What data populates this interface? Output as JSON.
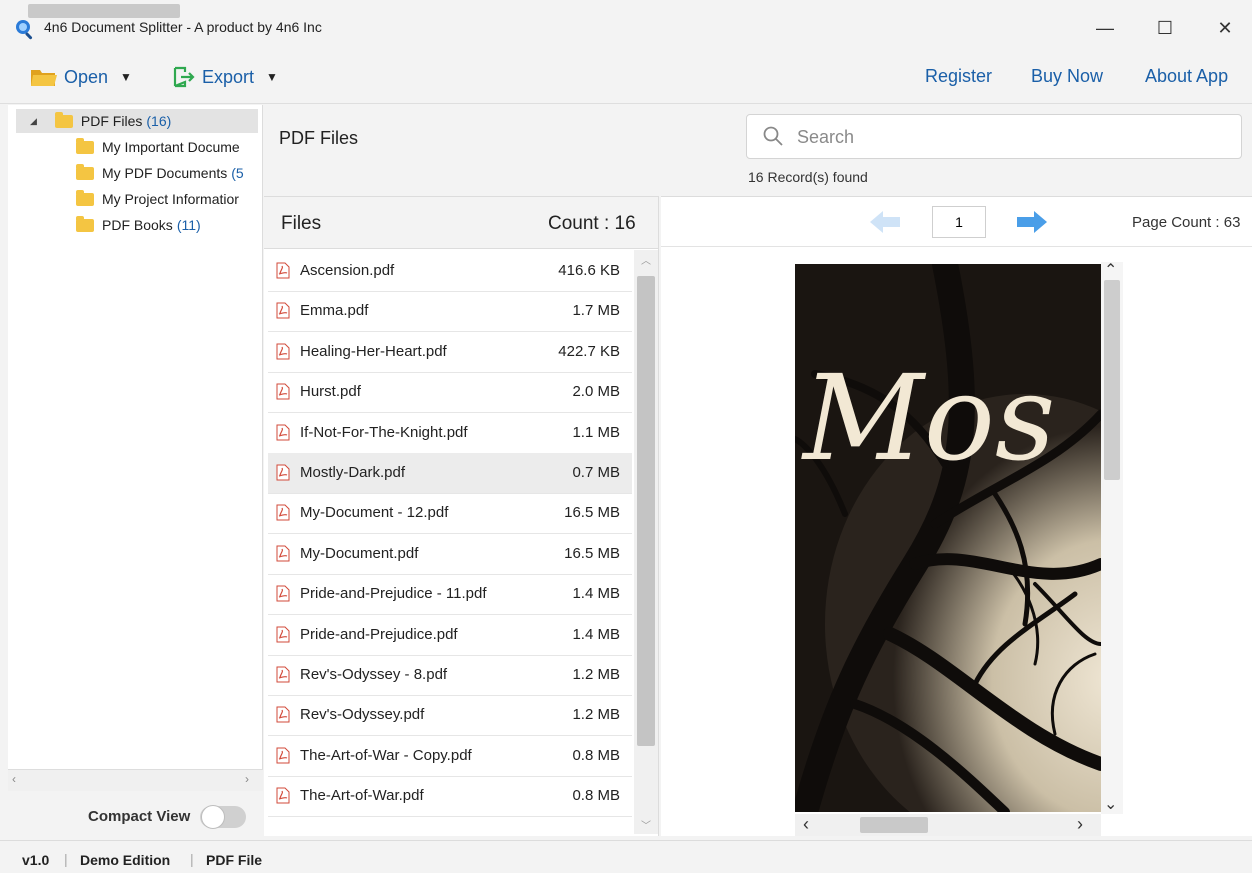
{
  "window": {
    "title": "4n6 Document Splitter - A product by 4n6 Inc",
    "minimize_glyph": "—",
    "maximize_glyph": "☐",
    "close_glyph": "✕"
  },
  "toolbar": {
    "open_label": "Open",
    "export_label": "Export",
    "register_label": "Register",
    "buy_now_label": "Buy Now",
    "about_label": "About App",
    "accent_color": "#1a5fa8"
  },
  "tree": {
    "root": {
      "label": "PDF Files",
      "count": "(16)"
    },
    "items": [
      {
        "label": "My Important Docume",
        "count": ""
      },
      {
        "label": "My PDF Documents",
        "count": "(5"
      },
      {
        "label": "My Project Informatior",
        "count": ""
      },
      {
        "label": "PDF Books",
        "count": "(11)"
      }
    ],
    "compact_view_label": "Compact View"
  },
  "main": {
    "title": "PDF Files",
    "search_placeholder": "Search",
    "records_found": "16 Record(s) found"
  },
  "files": {
    "header_label": "Files",
    "count_label": "Count : 16",
    "rows": [
      {
        "name": "Ascension.pdf",
        "size": "416.6 KB"
      },
      {
        "name": "Emma.pdf",
        "size": "1.7 MB"
      },
      {
        "name": "Healing-Her-Heart.pdf",
        "size": "422.7 KB"
      },
      {
        "name": "Hurst.pdf",
        "size": "2.0 MB"
      },
      {
        "name": "If-Not-For-The-Knight.pdf",
        "size": "1.1 MB"
      },
      {
        "name": "Mostly-Dark.pdf",
        "size": "0.7 MB",
        "selected": true
      },
      {
        "name": "My-Document - 12.pdf",
        "size": "16.5 MB"
      },
      {
        "name": "My-Document.pdf",
        "size": "16.5 MB"
      },
      {
        "name": "Pride-and-Prejudice - 11.pdf",
        "size": "1.4 MB"
      },
      {
        "name": "Pride-and-Prejudice.pdf",
        "size": "1.4 MB"
      },
      {
        "name": "Rev's-Odyssey - 8.pdf",
        "size": "1.2 MB"
      },
      {
        "name": "Rev's-Odyssey.pdf",
        "size": "1.2 MB"
      },
      {
        "name": "The-Art-of-War - Copy.pdf",
        "size": "0.8 MB"
      },
      {
        "name": "The-Art-of-War.pdf",
        "size": "0.8 MB"
      }
    ]
  },
  "preview": {
    "page_number": "1",
    "page_count_label": "Page Count : 63",
    "cover_text": "Mos"
  },
  "status": {
    "version": "v1.0",
    "edition": "Demo Edition",
    "mode": "PDF File"
  }
}
